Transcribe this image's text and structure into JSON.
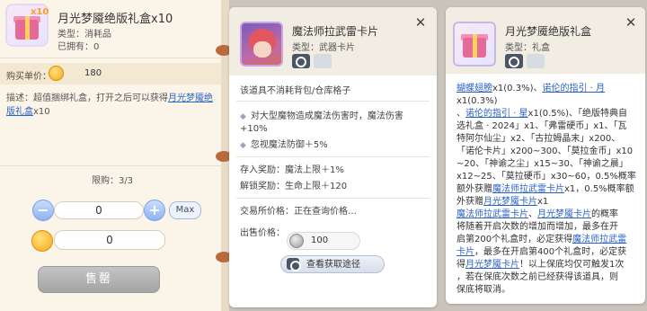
{
  "purchase": {
    "item_title": "月光梦魇绝版礼盒x10",
    "badge": "x10",
    "type_line": "类型：消耗品",
    "owned_line": "已拥有：0",
    "unit_price_label": "购买单价：",
    "unit_price": "180",
    "desc_prefix": "描述：超值捆绑礼盒，打开之后可以获得",
    "desc_link": "月光梦魇绝版礼盒",
    "desc_suffix": "x10",
    "limit": "限购：3/3",
    "qty_minus": "−",
    "qty_value": "0",
    "qty_plus": "+",
    "max_label": "Max",
    "total_value": "0",
    "sell_label": "售罄"
  },
  "card_mid": {
    "title": "魔法师拉武雷卡片",
    "type_line": "类型：武器卡片",
    "close": "✕",
    "notice": "该道具不消耗背包/仓库格子",
    "effect1": "对大型魔物造成魔法伤害时，魔法伤害",
    "effect1b": "+10%",
    "effect2": "忽视魔法防御＋5%",
    "deposit_reward": "存入奖励：魔法上限＋1%",
    "unlock_reward": "解锁奖励：生命上限＋120",
    "market_price": "交易所价格：正在查询价格…",
    "sell_price_label": "出售价格：",
    "sell_price": "100",
    "route_button": "查看获取途径"
  },
  "card_right": {
    "title": "月光梦魇绝版礼盒",
    "type_line": "类型：礼盒",
    "close": "✕",
    "lines": [
      [
        {
          "t": "蝴蝶翅膀",
          "l": true
        },
        {
          "t": "x1(0.3%)、"
        },
        {
          "t": "诺伦的指引 · 月",
          "l": true
        },
        {
          "t": "x1(0.3%)"
        }
      ],
      [
        {
          "t": "、"
        },
        {
          "t": "诺伦的指引 · 星",
          "l": true
        },
        {
          "t": "x1(0.5%)、「绝版特典自"
        }
      ],
      [
        {
          "t": "选礼盒 · 2024」x1、「弗雷硬币」x1、「瓦"
        }
      ],
      [
        {
          "t": "特阿尔仙尘」x2、「古拉姆晶末」x200、"
        }
      ],
      [
        {
          "t": "「诺伦卡片」x200~300、「莫拉金币」x10"
        }
      ],
      [
        {
          "t": "~20、「神谕之尘」x15~30、「神谕之晨」"
        }
      ],
      [
        {
          "t": "x12~25、「莫拉硬币」x30~60，0.5%概率"
        }
      ],
      [
        {
          "t": "额外获赠"
        },
        {
          "t": "魔法师拉武雷卡片",
          "l": true
        },
        {
          "t": "x1，0.5%概率额"
        }
      ],
      [
        {
          "t": "外获赠"
        },
        {
          "t": "月光梦魇卡片",
          "l": true
        },
        {
          "t": "x1"
        }
      ],
      [
        {
          "t": "魔法师拉武雷卡片",
          "l": true
        },
        {
          "t": "、"
        },
        {
          "t": "月光梦魇卡片",
          "l": true
        },
        {
          "t": "的概率"
        }
      ],
      [
        {
          "t": "将随着开启次数的增加而增加，最多在开"
        }
      ],
      [
        {
          "t": "启第200个礼盒时，必定获得"
        },
        {
          "t": "魔法师拉武雷",
          "l": true
        }
      ],
      [
        {
          "t": "卡片",
          "l": true
        },
        {
          "t": "，最多在开启第400个礼盒时，必定获"
        }
      ],
      [
        {
          "t": "得"
        },
        {
          "t": "月光梦魇卡片",
          "l": true
        },
        {
          "t": "！以上保底均仅可触发1次"
        }
      ],
      [
        {
          "t": "，若在保底次数之前已经获得该道具，则"
        }
      ],
      [
        {
          "t": "保底将取消。"
        }
      ]
    ]
  }
}
